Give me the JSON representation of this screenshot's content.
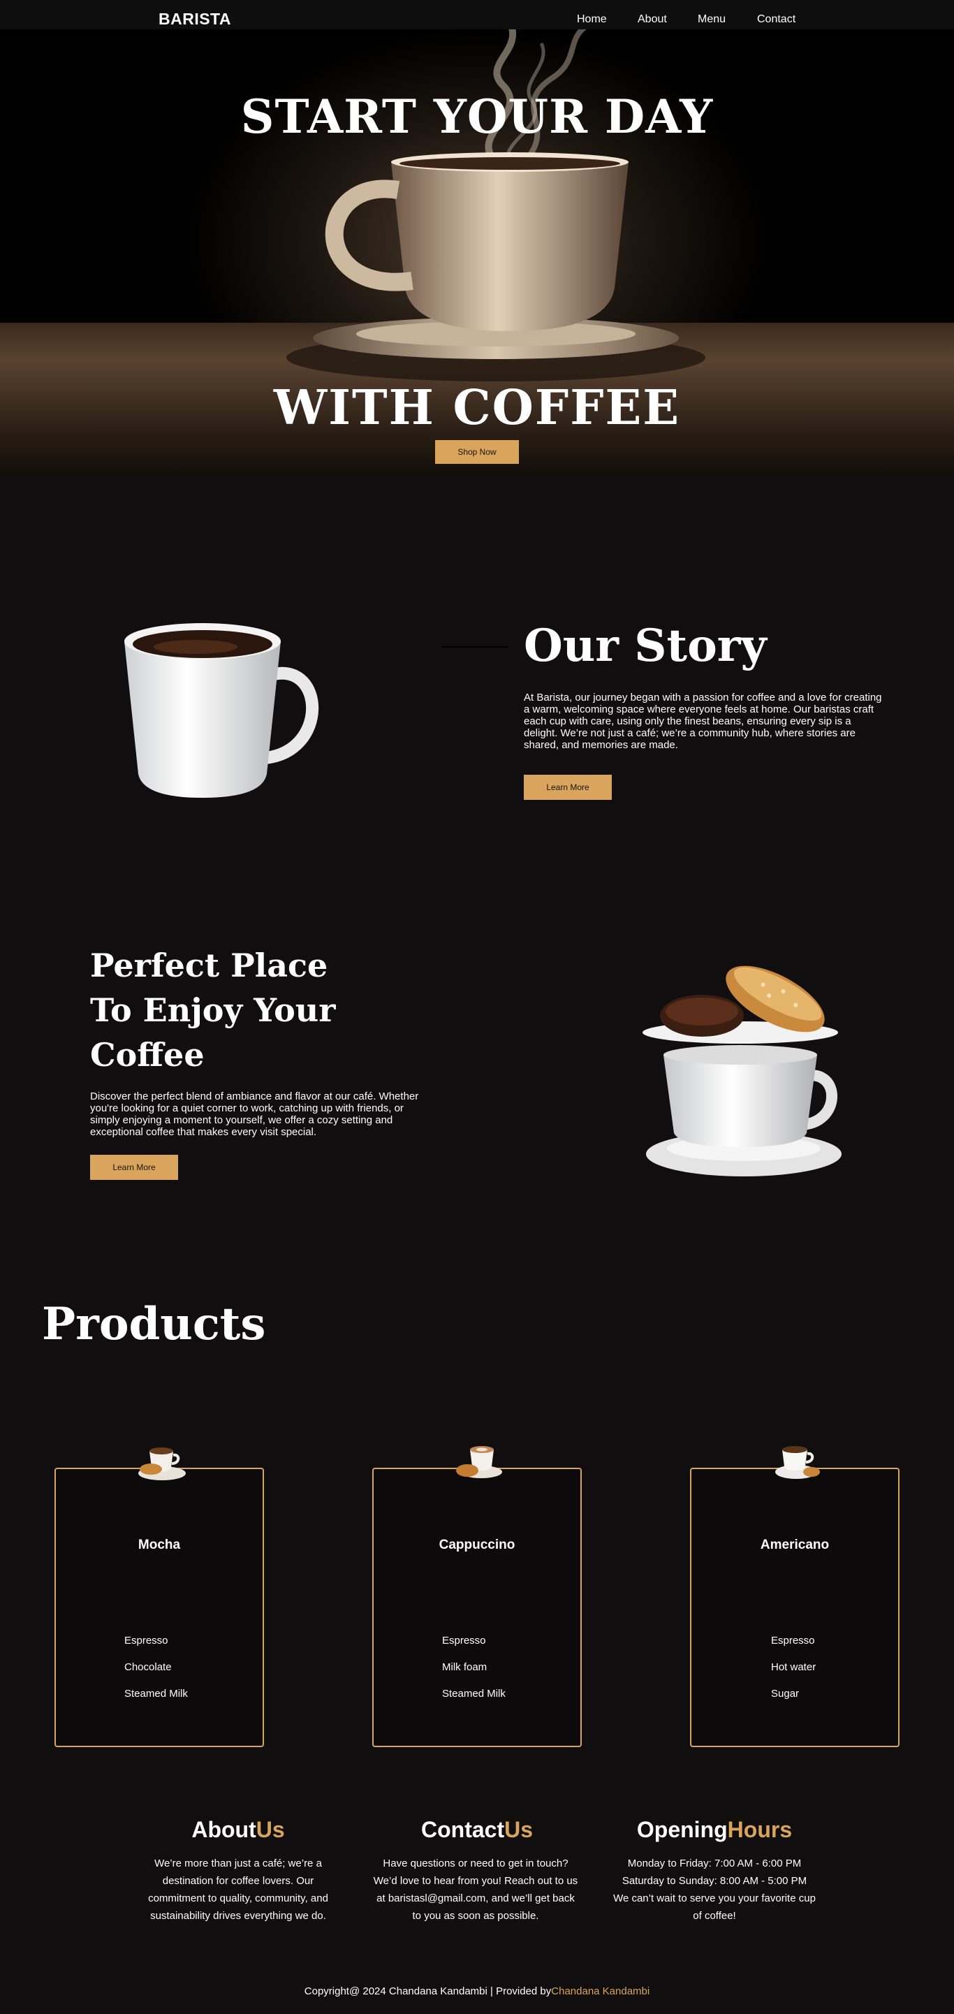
{
  "nav": {
    "logo": "BARISTA",
    "links": [
      "Home",
      "About",
      "Menu",
      "Contact"
    ]
  },
  "hero": {
    "title_line1": "START YOUR DAY",
    "title_line2": "WITH COFFEE",
    "button": "Shop Now"
  },
  "story": {
    "title": "Our Story",
    "text": "At Barista, our journey began with a passion for coffee and a love for creating a warm, welcoming space where everyone feels at home. Our baristas craft each cup with care, using only the finest beans, ensuring every sip is a delight. We’re not just a café; we’re a community hub, where stories are shared, and memories are made.",
    "button": "Learn More"
  },
  "place": {
    "title_lines": [
      "Perfect Place",
      "To Enjoy Your",
      "Coffee"
    ],
    "text": "Discover the perfect blend of ambiance and flavor at our café. Whether you're looking for a quiet corner to work, catching up with friends, or simply enjoying a moment to yourself, we offer a cozy setting and exceptional coffee that makes every visit special.",
    "button": "Learn More"
  },
  "products": {
    "title": "Products",
    "items": [
      {
        "name": "Mocha",
        "ingredients": [
          "Espresso",
          "Chocolate",
          "Steamed Milk"
        ]
      },
      {
        "name": "Cappuccino",
        "ingredients": [
          "Espresso",
          "Milk foam",
          "Steamed Milk"
        ]
      },
      {
        "name": "Americano",
        "ingredients": [
          "Espresso",
          "Hot water",
          "Sugar"
        ]
      }
    ]
  },
  "footer": {
    "about": {
      "title": "About",
      "accent": "Us",
      "text": "We’re more than just a café; we’re a destination for coffee lovers. Our commitment to quality, community, and sustainability drives everything we do."
    },
    "contact": {
      "title": "Contact",
      "accent": "Us",
      "text": "Have questions or need to get in touch? We’d love to hear from you! Reach out to us at baristasl@gmail.com, and we’ll get back to you as soon as possible."
    },
    "hours": {
      "title": "Opening",
      "accent": "Hours",
      "text": "Monday to Friday: 7:00 AM - 6:00 PM Saturday to Sunday: 8:00 AM - 5:00 PM We can’t wait to serve you your favorite cup of coffee!"
    },
    "copyright": "Copyright@ 2024 Chandana Kandambi | Provided by",
    "copyright_link": "Chandana Kandambi"
  },
  "colors": {
    "accent": "#d9a55c",
    "background": "#100e0e"
  },
  "icons": [
    "coffee-cup-steam-image",
    "coffee-cup-image",
    "donut-cup-image",
    "product-coffee-image"
  ]
}
